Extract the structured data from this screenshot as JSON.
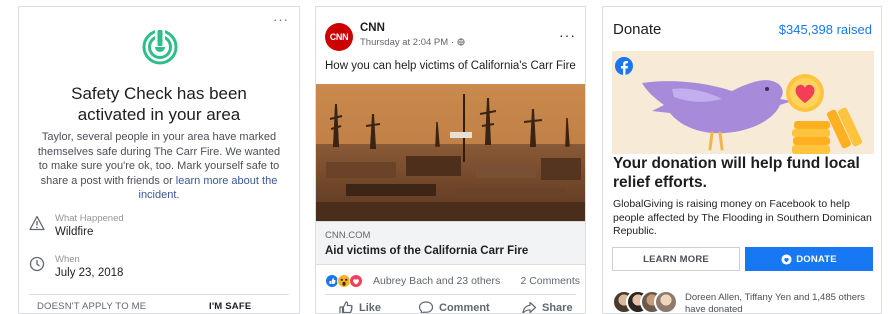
{
  "safety_card": {
    "more_label": "···",
    "title": "Safety Check has been activated in your area",
    "body_text": "Taylor, several people in your area have marked themselves safe during The Carr Fire. We wanted to make sure you're ok, too. Mark yourself safe to share a post with friends or ",
    "body_link": "learn more about the incident",
    "body_end": ".",
    "what_label": "What Happened",
    "what_value": "Wildfire",
    "when_label": "When",
    "when_value": "July 23, 2018",
    "btn_not_apply": "DOESN'T APPLY TO ME",
    "btn_safe": "I'M SAFE",
    "icons": {
      "main": "safety-check-icon",
      "what": "warning-icon",
      "when": "clock-icon"
    },
    "colors": {
      "accent": "#2dbe8b"
    }
  },
  "cnn_post": {
    "logo_text": "CNN",
    "author": "CNN",
    "meta": "Thursday at 2:04 PM · ",
    "privacy_icon": "globe-icon",
    "more_label": "···",
    "text": "How you can help victims of California's Carr Fire",
    "image_icon": "wildfire-aftermath-photo",
    "link_domain": "CNN.COM",
    "link_title": "Aid victims of the California Carr Fire",
    "reaction_names": "Aubrey Bach and 23 others",
    "comment_count": "2 Comments",
    "actions": {
      "like": "Like",
      "comment": "Comment",
      "share": "Share"
    },
    "colors": {
      "brand": "#cc0000",
      "link_bg": "#f2f3f5"
    }
  },
  "donate_card": {
    "header": "Donate",
    "raised": "$345,398 raised",
    "headline": "Your donation will help fund local relief efforts.",
    "description": "GlobalGiving is raising money on Facebook to help people affected by The Flooding in Southern Dominican Republic.",
    "btn_learn": "LEARN MORE",
    "btn_donate": "DONATE",
    "donors_text": "Doreen Allen, Tiffany Yen and 1,485 others have donated",
    "icons": {
      "art": "bird-heart-coins-illustration",
      "brand": "facebook-icon"
    },
    "colors": {
      "accent": "#1877f2",
      "art_bg": "#f7ead6"
    }
  }
}
